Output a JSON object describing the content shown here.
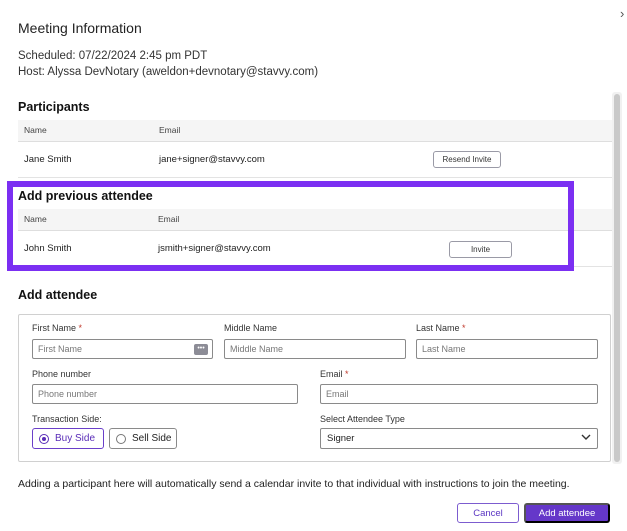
{
  "modal": {
    "title": "Meeting Information",
    "close_icon": "chevron-right-icon"
  },
  "meeting": {
    "scheduled": "Scheduled: 07/22/2024 2:45 pm PDT",
    "host": "Host: Alyssa DevNotary (aweldon+devnotary@stavvy.com)"
  },
  "participants": {
    "heading": "Participants",
    "columns": [
      "Name",
      "Email"
    ],
    "rows": [
      {
        "name": "Jane Smith",
        "email": "jane+signer@stavvy.com",
        "action": "Resend Invite"
      }
    ]
  },
  "previous_attendees": {
    "heading": "Add previous attendee",
    "columns": [
      "Name",
      "Email"
    ],
    "rows": [
      {
        "name": "John Smith",
        "email": "jsmith+signer@stavvy.com",
        "action": "Invite"
      }
    ],
    "highlight_color": "#7b2ff2"
  },
  "add_attendee": {
    "heading": "Add attendee",
    "first_name": {
      "label": "First Name",
      "required": "*",
      "placeholder": "First Name"
    },
    "middle_name": {
      "label": "Middle Name",
      "placeholder": "Middle Name"
    },
    "last_name": {
      "label": "Last Name",
      "required": "*",
      "placeholder": "Last Name"
    },
    "phone": {
      "label": "Phone number",
      "placeholder": "Phone number"
    },
    "email": {
      "label": "Email",
      "required": "*",
      "placeholder": "Email"
    },
    "transaction_side": {
      "label": "Transaction Side:",
      "options": [
        "Buy Side",
        "Sell Side"
      ],
      "selected": "Buy Side"
    },
    "attendee_type": {
      "label": "Select Attendee Type",
      "value": "Signer"
    }
  },
  "footer": {
    "note": "Adding a participant here will automatically send a calendar invite to that individual with instructions to join the meeting.",
    "cancel_label": "Cancel",
    "submit_label": "Add attendee"
  },
  "colors": {
    "accent": "#6537c9",
    "required": "#c0392b"
  }
}
